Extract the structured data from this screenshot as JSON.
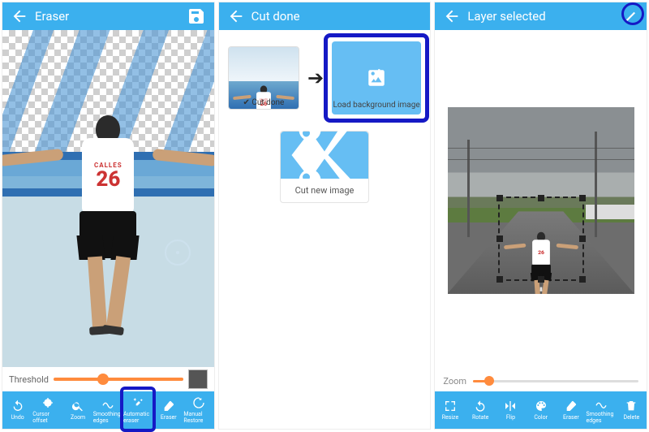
{
  "panel1": {
    "title": "Eraser",
    "jersey_name": "CALLES",
    "jersey_number": "26",
    "threshold_label": "Threshold",
    "threshold_value": 38,
    "tools": [
      "Undo",
      "Cursor offset",
      "Zoom",
      "Smoothing edges",
      "Automatic eraser",
      "Eraser",
      "Manual Restore"
    ]
  },
  "panel2": {
    "title": "Cut done",
    "cut_done_label": "Cut done",
    "load_bg_label": "Load background image",
    "cut_new_label": "Cut new image"
  },
  "panel3": {
    "title": "Layer selected",
    "zoom_label": "Zoom",
    "zoom_value": 10,
    "tools": [
      "Resize",
      "Rotate",
      "Flip",
      "Color",
      "Eraser",
      "Smoothing edges",
      "Delete"
    ]
  }
}
